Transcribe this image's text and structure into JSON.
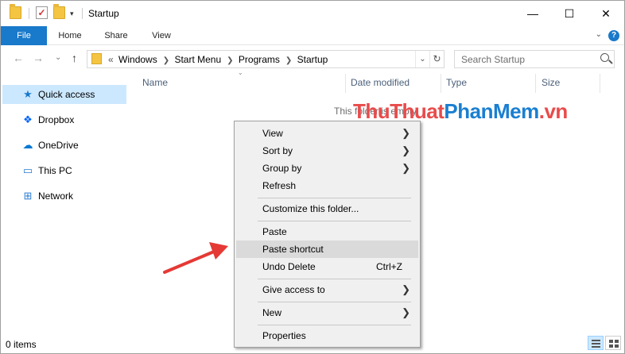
{
  "window": {
    "title": "Startup",
    "controls": [
      "—",
      "☐",
      "✕"
    ]
  },
  "ribbon": {
    "tabs": [
      "File",
      "Home",
      "Share",
      "View"
    ],
    "chevron": "⌄",
    "help": "?"
  },
  "nav": {
    "back": "←",
    "forward": "→",
    "recent": "⌄",
    "up": "↑",
    "breadcrumb_prefix": "«",
    "breadcrumbs": [
      "Windows",
      "Start Menu",
      "Programs",
      "Startup"
    ],
    "search_placeholder": "Search Startup"
  },
  "sidebar": {
    "items": [
      {
        "label": "Quick access",
        "icon": "star-icon",
        "glyph": "★",
        "color": "#1979ca"
      },
      {
        "label": "Dropbox",
        "icon": "dropbox-icon",
        "glyph": "❖",
        "color": "#0061fe"
      },
      {
        "label": "OneDrive",
        "icon": "onedrive-icon",
        "glyph": "☁",
        "color": "#0078d4"
      },
      {
        "label": "This PC",
        "icon": "computer-icon",
        "glyph": "▭",
        "color": "#2b7cd3"
      },
      {
        "label": "Network",
        "icon": "network-icon",
        "glyph": "⊞",
        "color": "#2b7cd3"
      }
    ]
  },
  "columns": [
    "Name",
    "Date modified",
    "Type",
    "Size"
  ],
  "content": {
    "empty_message": "This folder is empty."
  },
  "watermark": {
    "part1": "ThuThuat",
    "part2": "PhanMem",
    "part3": ".vn"
  },
  "context_menu": {
    "items": [
      {
        "label": "View",
        "submenu": true
      },
      {
        "label": "Sort by",
        "submenu": true
      },
      {
        "label": "Group by",
        "submenu": true
      },
      {
        "label": "Refresh"
      },
      {
        "label": "Customize this folder..."
      },
      {
        "label": "Paste"
      },
      {
        "label": "Paste shortcut",
        "highlighted": true
      },
      {
        "label": "Undo Delete",
        "shortcut": "Ctrl+Z"
      },
      {
        "label": "Give access to",
        "submenu": true
      },
      {
        "label": "New",
        "submenu": true
      },
      {
        "label": "Properties"
      }
    ]
  },
  "status_bar": {
    "item_count": "0 items"
  },
  "colors": {
    "accent": "#1979ca",
    "highlight": "#cce8ff",
    "arrow": "#e53935"
  }
}
